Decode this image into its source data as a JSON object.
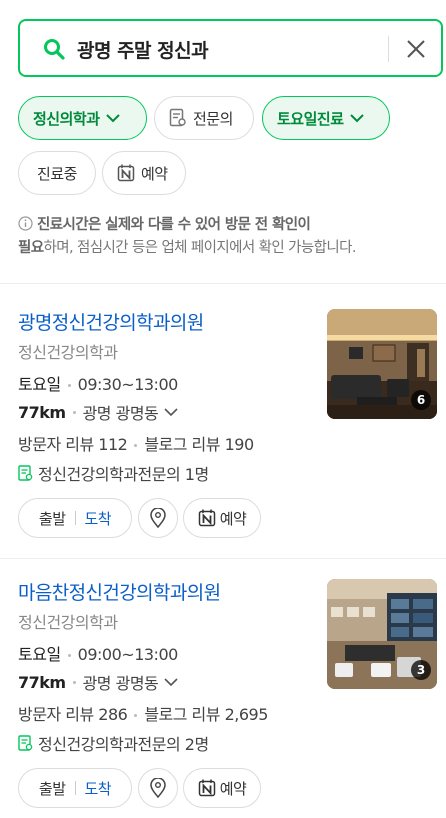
{
  "search": {
    "query": "광명 주말 정신과"
  },
  "filters": {
    "chip1": "정신의학과",
    "chip2": "전문의",
    "chip3": "토요일진료",
    "chip4": "진료중",
    "chip5": "예약"
  },
  "notice": {
    "bold1": "진료시간은 실제와 다를 수 있어 방문 전 확인이",
    "bold2": "필요",
    "rest": "하며, 점심시간 등은 업체 페이지에서 확인 가능합니다."
  },
  "results": [
    {
      "name": "광명정신건강의학과의원",
      "category": "정신건강의학과",
      "day": "토요일",
      "time": "09:30~13:00",
      "distance": "77km",
      "address": "광명 광명동",
      "visitor_reviews": "방문자 리뷰 112",
      "blog_reviews": "블로그 리뷰 190",
      "specialist": "정신건강의학과전문의 1명",
      "photo_count": "6",
      "depart_label": "출발",
      "arrive_label": "도착",
      "reserve_label": "예약"
    },
    {
      "name": "마음찬정신건강의학과의원",
      "category": "정신건강의학과",
      "day": "토요일",
      "time": "09:00~13:00",
      "distance": "77km",
      "address": "광명 광명동",
      "visitor_reviews": "방문자 리뷰 286",
      "blog_reviews": "블로그 리뷰 2,695",
      "specialist": "정신건강의학과전문의 2명",
      "photo_count": "3",
      "depart_label": "출발",
      "arrive_label": "도착",
      "reserve_label": "예약"
    }
  ],
  "colors": {
    "accent": "#03c75a",
    "link": "#0b5fc8"
  }
}
